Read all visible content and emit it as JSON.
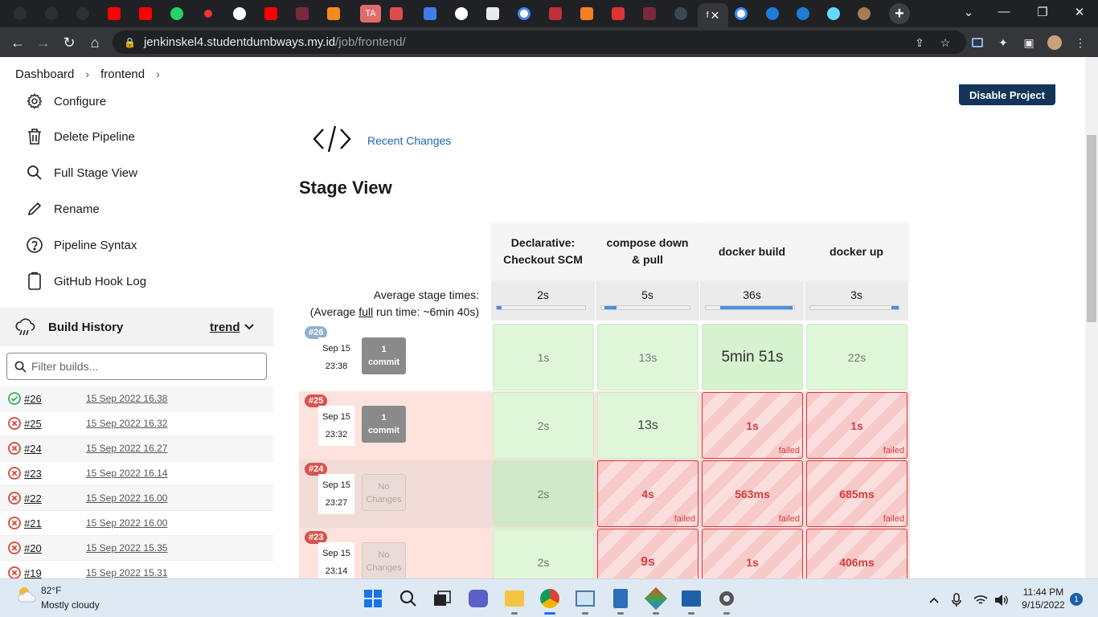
{
  "browser": {
    "url_host": "jenkinskel4.studentdumbways.my.id",
    "url_path": "/job/frontend/",
    "active_tab_label": "f"
  },
  "breadcrumb": [
    "Dashboard",
    "frontend"
  ],
  "header": {
    "disable_button": "Disable Project"
  },
  "sidebar": {
    "tasks": [
      {
        "label": "Configure",
        "icon": "gear-icon"
      },
      {
        "label": "Delete Pipeline",
        "icon": "trash-icon"
      },
      {
        "label": "Full Stage View",
        "icon": "search-icon"
      },
      {
        "label": "Rename",
        "icon": "pencil-icon"
      },
      {
        "label": "Pipeline Syntax",
        "icon": "help-icon"
      },
      {
        "label": "GitHub Hook Log",
        "icon": "clipboard-icon"
      }
    ],
    "build_history": {
      "title": "Build History",
      "trend": "trend",
      "filter_placeholder": "Filter builds...",
      "builds": [
        {
          "num": "#26",
          "date": "15 Sep 2022 16.38",
          "status": "success"
        },
        {
          "num": "#25",
          "date": "15 Sep 2022 16.32",
          "status": "failed"
        },
        {
          "num": "#24",
          "date": "15 Sep 2022 16.27",
          "status": "failed"
        },
        {
          "num": "#23",
          "date": "15 Sep 2022 16.14",
          "status": "failed"
        },
        {
          "num": "#22",
          "date": "15 Sep 2022 16.00",
          "status": "failed"
        },
        {
          "num": "#21",
          "date": "15 Sep 2022 16.00",
          "status": "failed"
        },
        {
          "num": "#20",
          "date": "15 Sep 2022 15.35",
          "status": "failed"
        },
        {
          "num": "#19",
          "date": "15 Sep 2022 15.31",
          "status": "failed"
        }
      ]
    }
  },
  "main": {
    "recent_changes": "Recent Changes",
    "stage_view_title": "Stage View",
    "avg_label_1": "Average stage times:",
    "avg_label_2a": "(Average ",
    "avg_label_2b": "full",
    "avg_label_2c": " run time: ~6min 40s)",
    "stages": [
      {
        "name_l1": "Declarative:",
        "name_l2": "Checkout SCM",
        "avg": "2s",
        "avg_frac": 0.05
      },
      {
        "name_l1": "compose down",
        "name_l2": "& pull",
        "avg": "5s",
        "avg_frac": 0.14
      },
      {
        "name_l1": "",
        "name_l2": "docker build",
        "avg": "36s",
        "avg_frac": 0.82
      },
      {
        "name_l1": "",
        "name_l2": "docker up",
        "avg": "3s",
        "avg_frac": 0.08
      }
    ],
    "runs": [
      {
        "badge": "#26",
        "date": "Sep 15",
        "time": "23:38",
        "changes_l1": "1",
        "changes_l2": "commit",
        "row_state": "ok",
        "cells": [
          {
            "t": "1s",
            "s": "ok"
          },
          {
            "t": "13s",
            "s": "ok"
          },
          {
            "t": "5min 51s",
            "s": "ok"
          },
          {
            "t": "22s",
            "s": "ok"
          }
        ]
      },
      {
        "badge": "#25",
        "date": "Sep 15",
        "time": "23:32",
        "changes_l1": "1",
        "changes_l2": "commit",
        "row_state": "fail",
        "cells": [
          {
            "t": "2s",
            "s": "ok"
          },
          {
            "t": "13s",
            "s": "ok"
          },
          {
            "t": "1s",
            "s": "fail"
          },
          {
            "t": "1s",
            "s": "fail"
          }
        ]
      },
      {
        "badge": "#24",
        "date": "Sep 15",
        "time": "23:27",
        "changes_l1": "No",
        "changes_l2": "Changes",
        "row_state": "fail",
        "cells": [
          {
            "t": "2s",
            "s": "ok"
          },
          {
            "t": "4s",
            "s": "fail"
          },
          {
            "t": "563ms",
            "s": "fail"
          },
          {
            "t": "685ms",
            "s": "fail"
          }
        ]
      },
      {
        "badge": "#23",
        "date": "Sep 15",
        "time": "23:14",
        "changes_l1": "No",
        "changes_l2": "Changes",
        "row_state": "fail",
        "cells": [
          {
            "t": "2s",
            "s": "ok"
          },
          {
            "t": "9s",
            "s": "fail"
          },
          {
            "t": "1s",
            "s": "fail"
          },
          {
            "t": "406ms",
            "s": "fail"
          }
        ]
      }
    ],
    "failed_label": "failed"
  },
  "taskbar": {
    "weather_temp": "82°F",
    "weather_desc": "Mostly cloudy",
    "time": "11:44 PM",
    "date": "9/15/2022",
    "notif_count": "1"
  }
}
